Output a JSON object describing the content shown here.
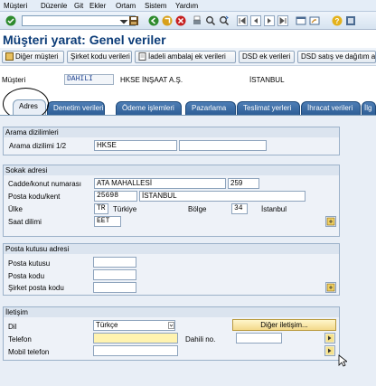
{
  "menu": [
    "Müşteri",
    "Düzenle",
    "Git",
    "Ekler",
    "Ortam",
    "Sistem",
    "Yardım"
  ],
  "icons": [
    "enter-icon",
    "save-icon",
    "back-icon",
    "exit-icon",
    "cancel-icon",
    "print-icon",
    "find-icon",
    "find-next-icon",
    "first-page-icon",
    "prev-page-icon",
    "next-page-icon",
    "last-page-icon",
    "new-session-icon",
    "shortcut-icon",
    "help-icon",
    "customize-icon"
  ],
  "title": "Müşteri yarat: Genel veriler",
  "app_toolbar": [
    "Diğer müşteri",
    "Şirket kodu verileri",
    "İadeli ambalaj ek verileri",
    "DSD ek verileri",
    "DSD satış ve dağıtım al"
  ],
  "header": {
    "label": "Müşteri",
    "customer_id": "DAHILI",
    "name": "HKSE İNŞAAT A.Ş.",
    "city": "İSTANBUL"
  },
  "tabs": [
    "Adres",
    "Denetim verileri",
    "Ödeme işlemleri",
    "Pazarlama",
    "Teslimat yerleri",
    "İhracat verileri",
    "İlg"
  ],
  "active_tab": "Adres",
  "search_terms": {
    "title": "Arama dizilimleri",
    "label": "Arama dizilimi 1/2",
    "value1": "HKSE",
    "value2": ""
  },
  "street_address": {
    "title": "Sokak adresi",
    "street_label": "Cadde/konut numarası",
    "street": "ATA MAHALLESİ",
    "house_no": "259",
    "postal_label": "Posta kodu/kent",
    "postal_code": "25698",
    "city": "İSTANBUL",
    "country_label": "Ülke",
    "country_code": "TR",
    "country_name": "Türkiye",
    "region_label": "Bölge",
    "region_code": "34",
    "region_name": "İstanbul",
    "timezone_label": "Saat dilimi",
    "timezone": "EET"
  },
  "po_box": {
    "title": "Posta kutusu adresi",
    "box_label": "Posta kutusu",
    "code_label": "Posta kodu",
    "company_code_label": "Şirket posta kodu"
  },
  "communication": {
    "title": "İletişim",
    "language_label": "Dil",
    "language": "Türkçe",
    "other_button": "Diğer iletişim...",
    "phone_label": "Telefon",
    "extension_label": "Dahili no.",
    "mobile_label": "Mobil telefon"
  },
  "colors": {
    "title": "#0c3c78",
    "tab_bg": "#2f5f96",
    "content_bg": "#e8eef6",
    "required": "#fff3b0"
  }
}
